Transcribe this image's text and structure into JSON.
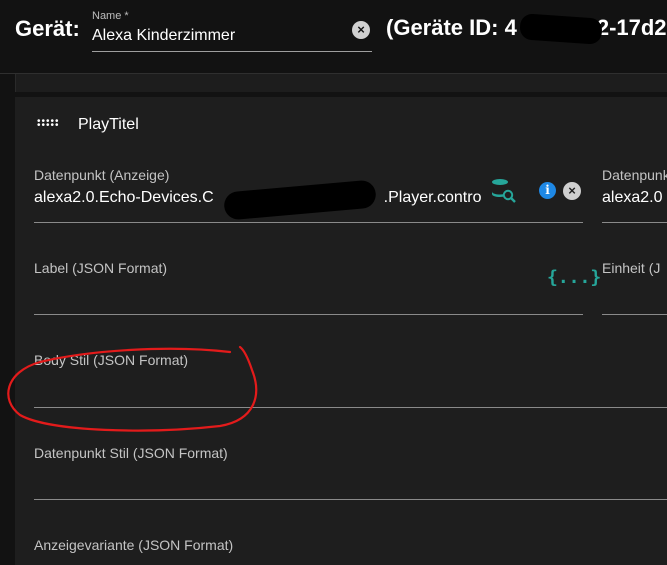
{
  "header": {
    "device_label": "Gerät:",
    "name_caption": "Name *",
    "name_value": "Alexa Kinderzimmer",
    "device_id_prefix": "(Geräte ID: 4",
    "device_id_suffix": "2-17d2"
  },
  "panel": {
    "title": "PlayTitel",
    "datapoint": {
      "label": "Datenpunkt (Anzeige)",
      "value_start": "alexa2.0.Echo-Devices.C",
      "value_end": ".Player.contro"
    },
    "datapoint2": {
      "label": "Datenpunk",
      "value": "alexa2.0"
    },
    "label_json": {
      "label": "Label (JSON Format)",
      "value": ""
    },
    "unit": {
      "label": "Einheit (J"
    },
    "body_style": {
      "label": "Body Stil (JSON Format)",
      "value": ""
    },
    "dp_style": {
      "label": "Datenpunkt Stil (JSON Format)",
      "value": ""
    },
    "display_variant": {
      "label": "Anzeigevariante (JSON Format)"
    }
  },
  "icons": {
    "database_search": "database-search-icon",
    "info": "info-icon",
    "clear": "close-circle-icon",
    "json": "code-json-icon",
    "drag": "drag-handle-icon",
    "json_glyph": "{...}",
    "info_glyph": "i",
    "clear_glyph": "×"
  },
  "colors": {
    "background": "#121212",
    "panel": "#1e1e1e",
    "accent_teal": "#26a69a",
    "info_blue": "#1e88e5",
    "annotation_red": "#e31b1b"
  }
}
